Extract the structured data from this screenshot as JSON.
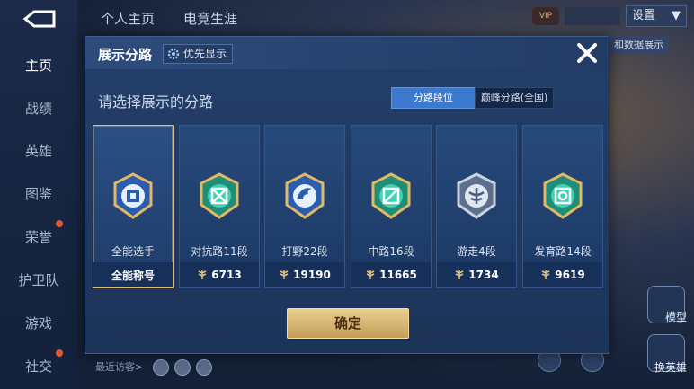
{
  "sidebar": {
    "items": [
      {
        "label": "主页",
        "active": true
      },
      {
        "label": "战绩"
      },
      {
        "label": "英雄"
      },
      {
        "label": "图鉴"
      },
      {
        "label": "荣誉",
        "dot": true
      },
      {
        "label": "护卫队"
      },
      {
        "label": "游戏"
      },
      {
        "label": "社交",
        "dot": true
      }
    ]
  },
  "topbar": {
    "tabs": [
      "个人主页",
      "电竞生涯"
    ],
    "settings_label": "设置",
    "vip_label": "VIP"
  },
  "right_panel": {
    "strip_text": "和数据展示",
    "btn_1_label": "模型",
    "btn_2_label": "换英雄"
  },
  "bottom": {
    "visitors_label": "最近访客>"
  },
  "modal": {
    "title": "展示分路",
    "priority_label": "优先显示",
    "subtitle": "请选择展示的分路",
    "segments": [
      "分路段位",
      "巅峰分路(全国)"
    ],
    "cards": [
      {
        "label": "全能选手",
        "foot": "全能称号",
        "badge": "allround-badge-icon",
        "selected": true
      },
      {
        "label": "对抗路11段",
        "foot": "6713",
        "badge": "clash-lane-badge-icon"
      },
      {
        "label": "打野22段",
        "foot": "19190",
        "badge": "jungle-badge-icon"
      },
      {
        "label": "中路16段",
        "foot": "11665",
        "badge": "mid-lane-badge-icon"
      },
      {
        "label": "游走4段",
        "foot": "1734",
        "badge": "roam-badge-icon"
      },
      {
        "label": "发育路14段",
        "foot": "9619",
        "badge": "farm-lane-badge-icon"
      }
    ],
    "confirm_label": "确定"
  },
  "colors": {
    "accent_blue": "#3c7ad0",
    "gold": "#d8b97a",
    "modal_bg": "#1d3459"
  }
}
